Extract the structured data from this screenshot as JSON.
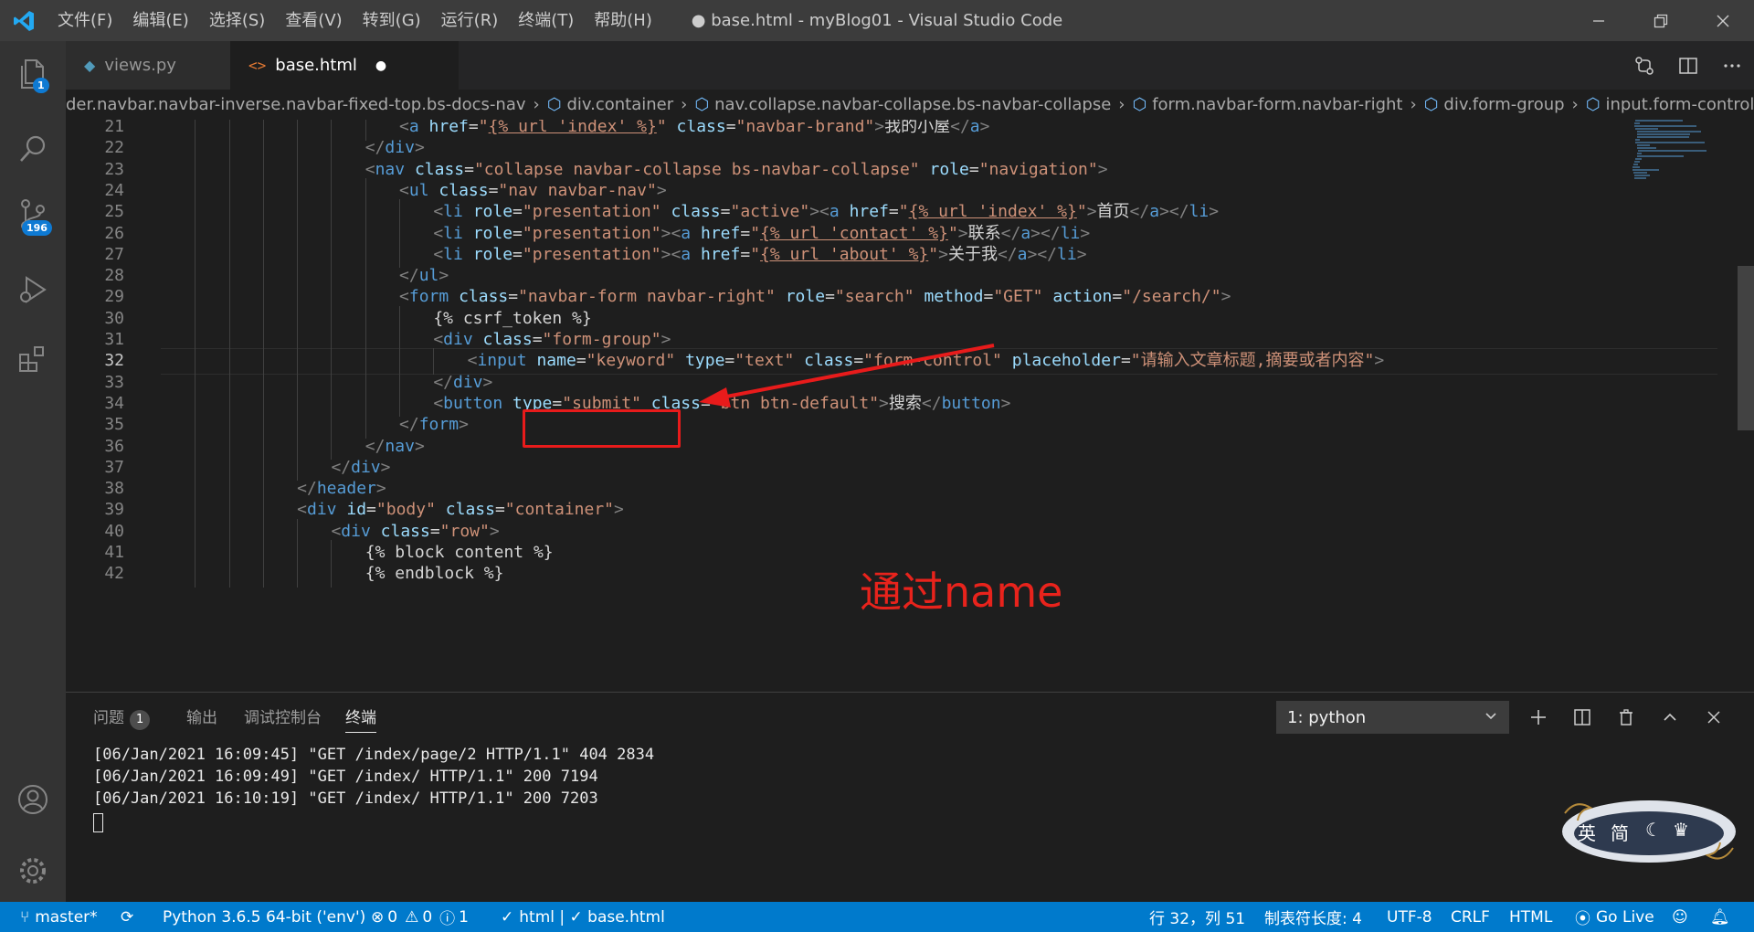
{
  "window": {
    "title": "● base.html - myBlog01 - Visual Studio Code",
    "menu": [
      "文件(F)",
      "编辑(E)",
      "选择(S)",
      "查看(V)",
      "转到(G)",
      "运行(R)",
      "终端(T)",
      "帮助(H)"
    ]
  },
  "activity": {
    "explorer_badge": "1",
    "scm_badge": "196"
  },
  "tabs": [
    {
      "label": "views.py",
      "icon": "python-icon"
    },
    {
      "label": "base.html",
      "icon": "html-icon",
      "modified_dot": "●"
    }
  ],
  "breadcrumb": [
    "der.navbar.navbar-inverse.navbar-fixed-top.bs-docs-nav",
    "div.container",
    "nav.collapse.navbar-collapse.bs-navbar-collapse",
    "form.navbar-form.navbar-right",
    "div.form-group",
    "input.form-control"
  ],
  "editor": {
    "current_line": 32,
    "lines": [
      {
        "n": "21",
        "indent": 7,
        "tokens": [
          [
            "b",
            "<"
          ],
          [
            "t",
            "a"
          ],
          [
            "x",
            " "
          ],
          [
            "a",
            "href"
          ],
          [
            "x",
            "="
          ],
          [
            "s",
            "\""
          ],
          [
            "u",
            "{% url 'index' %}"
          ],
          [
            "s",
            "\""
          ],
          [
            "x",
            " "
          ],
          [
            "a",
            "class"
          ],
          [
            "x",
            "="
          ],
          [
            "s",
            "\"navbar-brand\""
          ],
          [
            "b",
            ">"
          ],
          [
            "x",
            "我的小屋"
          ],
          [
            "b",
            "</"
          ],
          [
            "t",
            "a"
          ],
          [
            "b",
            ">"
          ]
        ]
      },
      {
        "n": "22",
        "indent": 6,
        "tokens": [
          [
            "b",
            "</"
          ],
          [
            "t",
            "div"
          ],
          [
            "b",
            ">"
          ]
        ]
      },
      {
        "n": "23",
        "indent": 6,
        "tokens": [
          [
            "b",
            "<"
          ],
          [
            "t",
            "nav"
          ],
          [
            "x",
            " "
          ],
          [
            "a",
            "class"
          ],
          [
            "x",
            "="
          ],
          [
            "s",
            "\"collapse navbar-collapse bs-navbar-collapse\""
          ],
          [
            "x",
            " "
          ],
          [
            "a",
            "role"
          ],
          [
            "x",
            "="
          ],
          [
            "s",
            "\"navigation\""
          ],
          [
            "b",
            ">"
          ]
        ]
      },
      {
        "n": "24",
        "indent": 7,
        "tokens": [
          [
            "b",
            "<"
          ],
          [
            "t",
            "ul"
          ],
          [
            "x",
            " "
          ],
          [
            "a",
            "class"
          ],
          [
            "x",
            "="
          ],
          [
            "s",
            "\"nav navbar-nav\""
          ],
          [
            "b",
            ">"
          ]
        ]
      },
      {
        "n": "25",
        "indent": 8,
        "tokens": [
          [
            "b",
            "<"
          ],
          [
            "t",
            "li"
          ],
          [
            "x",
            " "
          ],
          [
            "a",
            "role"
          ],
          [
            "x",
            "="
          ],
          [
            "s",
            "\"presentation\""
          ],
          [
            "x",
            " "
          ],
          [
            "a",
            "class"
          ],
          [
            "x",
            "="
          ],
          [
            "s",
            "\"active\""
          ],
          [
            "b",
            ">"
          ],
          [
            "b",
            "<"
          ],
          [
            "t",
            "a"
          ],
          [
            "x",
            " "
          ],
          [
            "a",
            "href"
          ],
          [
            "x",
            "="
          ],
          [
            "s",
            "\""
          ],
          [
            "u",
            "{% url 'index' %}"
          ],
          [
            "s",
            "\""
          ],
          [
            "b",
            ">"
          ],
          [
            "x",
            "首页"
          ],
          [
            "b",
            "</"
          ],
          [
            "t",
            "a"
          ],
          [
            "b",
            ">"
          ],
          [
            "b",
            "</"
          ],
          [
            "t",
            "li"
          ],
          [
            "b",
            ">"
          ]
        ]
      },
      {
        "n": "26",
        "indent": 8,
        "tokens": [
          [
            "b",
            "<"
          ],
          [
            "t",
            "li"
          ],
          [
            "x",
            " "
          ],
          [
            "a",
            "role"
          ],
          [
            "x",
            "="
          ],
          [
            "s",
            "\"presentation\""
          ],
          [
            "b",
            ">"
          ],
          [
            "b",
            "<"
          ],
          [
            "t",
            "a"
          ],
          [
            "x",
            " "
          ],
          [
            "a",
            "href"
          ],
          [
            "x",
            "="
          ],
          [
            "s",
            "\""
          ],
          [
            "u",
            "{% url 'contact' %}"
          ],
          [
            "s",
            "\""
          ],
          [
            "b",
            ">"
          ],
          [
            "x",
            "联系"
          ],
          [
            "b",
            "</"
          ],
          [
            "t",
            "a"
          ],
          [
            "b",
            ">"
          ],
          [
            "b",
            "</"
          ],
          [
            "t",
            "li"
          ],
          [
            "b",
            ">"
          ]
        ]
      },
      {
        "n": "27",
        "indent": 8,
        "tokens": [
          [
            "b",
            "<"
          ],
          [
            "t",
            "li"
          ],
          [
            "x",
            " "
          ],
          [
            "a",
            "role"
          ],
          [
            "x",
            "="
          ],
          [
            "s",
            "\"presentation\""
          ],
          [
            "b",
            ">"
          ],
          [
            "b",
            "<"
          ],
          [
            "t",
            "a"
          ],
          [
            "x",
            " "
          ],
          [
            "a",
            "href"
          ],
          [
            "x",
            "="
          ],
          [
            "s",
            "\""
          ],
          [
            "u",
            "{% url 'about' %}"
          ],
          [
            "s",
            "\""
          ],
          [
            "b",
            ">"
          ],
          [
            "x",
            "关于我"
          ],
          [
            "b",
            "</"
          ],
          [
            "t",
            "a"
          ],
          [
            "b",
            ">"
          ],
          [
            "b",
            "</"
          ],
          [
            "t",
            "li"
          ],
          [
            "b",
            ">"
          ]
        ]
      },
      {
        "n": "28",
        "indent": 7,
        "tokens": [
          [
            "b",
            "</"
          ],
          [
            "t",
            "ul"
          ],
          [
            "b",
            ">"
          ]
        ]
      },
      {
        "n": "29",
        "indent": 7,
        "tokens": [
          [
            "b",
            "<"
          ],
          [
            "t",
            "form"
          ],
          [
            "x",
            " "
          ],
          [
            "a",
            "class"
          ],
          [
            "x",
            "="
          ],
          [
            "s",
            "\"navbar-form navbar-right\""
          ],
          [
            "x",
            " "
          ],
          [
            "a",
            "role"
          ],
          [
            "x",
            "="
          ],
          [
            "s",
            "\"search\""
          ],
          [
            "x",
            " "
          ],
          [
            "a",
            "method"
          ],
          [
            "x",
            "="
          ],
          [
            "s",
            "\"GET\""
          ],
          [
            "x",
            " "
          ],
          [
            "a",
            "action"
          ],
          [
            "x",
            "="
          ],
          [
            "s",
            "\"/search/\""
          ],
          [
            "b",
            ">"
          ]
        ]
      },
      {
        "n": "30",
        "indent": 8,
        "tokens": [
          [
            "x",
            "{% csrf_token %}"
          ]
        ]
      },
      {
        "n": "31",
        "indent": 8,
        "tokens": [
          [
            "b",
            "<"
          ],
          [
            "t",
            "div"
          ],
          [
            "x",
            " "
          ],
          [
            "a",
            "class"
          ],
          [
            "x",
            "="
          ],
          [
            "s",
            "\"form-group\""
          ],
          [
            "b",
            ">"
          ]
        ]
      },
      {
        "n": "32",
        "indent": 9,
        "tokens": [
          [
            "b",
            "<"
          ],
          [
            "t",
            "input"
          ],
          [
            "x",
            " "
          ],
          [
            "a",
            "name"
          ],
          [
            "x",
            "="
          ],
          [
            "s",
            "\"keyword\""
          ],
          [
            "x",
            " "
          ],
          [
            "a",
            "type"
          ],
          [
            "x",
            "="
          ],
          [
            "s",
            "\"text\""
          ],
          [
            "x",
            " "
          ],
          [
            "a",
            "class"
          ],
          [
            "x",
            "="
          ],
          [
            "s",
            "\"form-control\""
          ],
          [
            "x",
            " "
          ],
          [
            "a",
            "placeholder"
          ],
          [
            "x",
            "="
          ],
          [
            "s",
            "\"请输入文章标题,摘要或者内容\""
          ],
          [
            "b",
            ">"
          ]
        ]
      },
      {
        "n": "33",
        "indent": 8,
        "tokens": [
          [
            "b",
            "</"
          ],
          [
            "t",
            "div"
          ],
          [
            "b",
            ">"
          ]
        ]
      },
      {
        "n": "34",
        "indent": 8,
        "tokens": [
          [
            "b",
            "<"
          ],
          [
            "t",
            "button"
          ],
          [
            "x",
            " "
          ],
          [
            "a",
            "type"
          ],
          [
            "x",
            "="
          ],
          [
            "s",
            "\"submit\""
          ],
          [
            "x",
            " "
          ],
          [
            "a",
            "class"
          ],
          [
            "x",
            "="
          ],
          [
            "s",
            "\"btn btn-default\""
          ],
          [
            "b",
            ">"
          ],
          [
            "x",
            "搜索"
          ],
          [
            "b",
            "</"
          ],
          [
            "t",
            "button"
          ],
          [
            "b",
            ">"
          ]
        ]
      },
      {
        "n": "35",
        "indent": 7,
        "tokens": [
          [
            "b",
            "</"
          ],
          [
            "t",
            "form"
          ],
          [
            "b",
            ">"
          ]
        ]
      },
      {
        "n": "36",
        "indent": 6,
        "tokens": [
          [
            "b",
            "</"
          ],
          [
            "t",
            "nav"
          ],
          [
            "b",
            ">"
          ]
        ]
      },
      {
        "n": "37",
        "indent": 5,
        "tokens": [
          [
            "b",
            "</"
          ],
          [
            "t",
            "div"
          ],
          [
            "b",
            ">"
          ]
        ]
      },
      {
        "n": "38",
        "indent": 4,
        "tokens": [
          [
            "b",
            "</"
          ],
          [
            "t",
            "header"
          ],
          [
            "b",
            ">"
          ]
        ]
      },
      {
        "n": "39",
        "indent": 4,
        "tokens": [
          [
            "b",
            "<"
          ],
          [
            "t",
            "div"
          ],
          [
            "x",
            " "
          ],
          [
            "a",
            "id"
          ],
          [
            "x",
            "="
          ],
          [
            "s",
            "\"body\""
          ],
          [
            "x",
            " "
          ],
          [
            "a",
            "class"
          ],
          [
            "x",
            "="
          ],
          [
            "s",
            "\"container\""
          ],
          [
            "b",
            ">"
          ]
        ]
      },
      {
        "n": "40",
        "indent": 5,
        "tokens": [
          [
            "b",
            "<"
          ],
          [
            "t",
            "div"
          ],
          [
            "x",
            " "
          ],
          [
            "a",
            "class"
          ],
          [
            "x",
            "="
          ],
          [
            "s",
            "\"row\""
          ],
          [
            "b",
            ">"
          ]
        ]
      },
      {
        "n": "41",
        "indent": 6,
        "tokens": [
          [
            "x",
            "{% block content %}"
          ]
        ]
      },
      {
        "n": "42",
        "indent": 6,
        "tokens": [
          [
            "x",
            "{% endblock %}"
          ]
        ]
      }
    ]
  },
  "annotation": {
    "text": "通过name",
    "color": "#e8231c"
  },
  "panel": {
    "tabs": [
      "问题",
      "输出",
      "调试控制台",
      "终端"
    ],
    "problems_count": "1",
    "active_tab": "终端",
    "terminal_select": "1: python",
    "terminal_lines": [
      "[06/Jan/2021 16:09:45] \"GET /index/page/2 HTTP/1.1\" 404 2834",
      "[06/Jan/2021 16:09:49] \"GET /index/ HTTP/1.1\" 200 7194",
      "[06/Jan/2021 16:10:19] \"GET /index/ HTTP/1.1\" 200 7203"
    ]
  },
  "ime": {
    "lang": "英",
    "mode": "简"
  },
  "status": {
    "branch": "master*",
    "python": "Python 3.6.5 64-bit ('env')",
    "errors": "0",
    "warnings": "0",
    "infos": "1",
    "lint": "html | ✓ base.html",
    "position": "行 32，列 51",
    "tab_size": "制表符长度: 4",
    "encoding": "UTF-8",
    "eol": "CRLF",
    "language": "HTML",
    "golive": "Go Live"
  },
  "colors": {
    "accent": "#007acc",
    "activity_bg": "#333333",
    "editor_bg": "#1e1e1e",
    "annotation_red": "#e81b1b"
  }
}
